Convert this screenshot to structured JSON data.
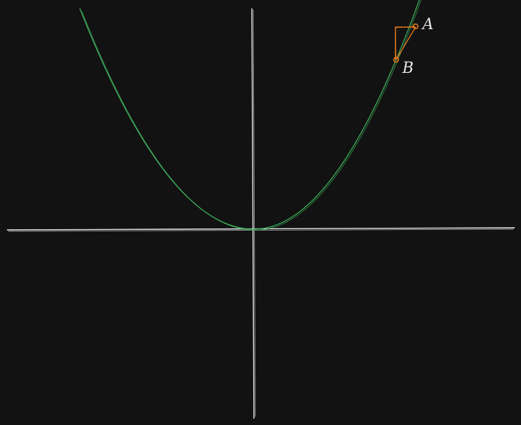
{
  "canvas": {
    "background": "#121212"
  },
  "axes": {
    "color": "#e8e8e8"
  },
  "curve": {
    "color": "#3fae5a"
  },
  "triangle": {
    "color": "#e0781c"
  },
  "points": [
    {
      "label": "A",
      "color": "#e0781c"
    },
    {
      "label": "B",
      "color": "#e0781c"
    }
  ],
  "label_color": "#e6e6e6"
}
